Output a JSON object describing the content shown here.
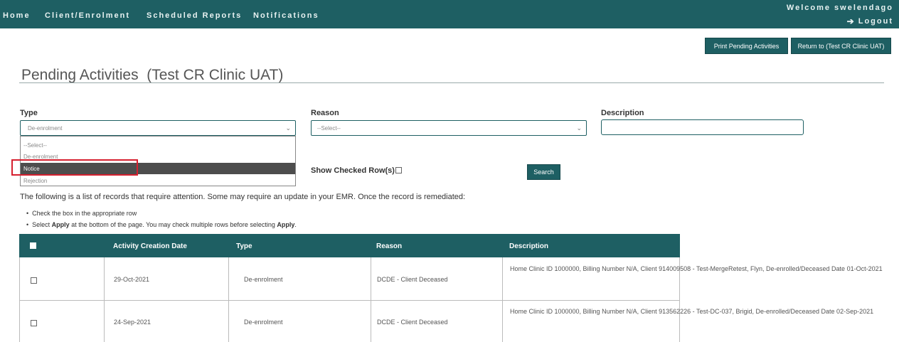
{
  "nav": {
    "items": [
      "Home",
      "Client/Enrolment",
      "Scheduled Reports",
      "Notifications"
    ],
    "welcome": "Welcome swelendago",
    "logout": "Logout"
  },
  "actions": {
    "print_label": "Print Pending Activities",
    "return_label": "Return to (Test CR Clinic UAT)"
  },
  "page": {
    "title": "Pending Activities  (Test CR Clinic UAT)"
  },
  "filters": {
    "type_label": "Type",
    "type_value": "De-enrolment",
    "type_options": [
      "--Select--",
      "De-enrolment",
      "Notice",
      "Rejection"
    ],
    "type_highlighted": "Notice",
    "reason_label": "Reason",
    "reason_value": "--Select--",
    "description_label": "Description",
    "description_value": "",
    "show_checked_label": "Show Checked Row(s)",
    "search_label": "Search"
  },
  "info": {
    "text": "The following is a list of records that require attention. Some may require an update in your EMR. Once the record is remediated:",
    "bullet1": "Check the box in the appropriate row",
    "bullet2_pre": "Select ",
    "bullet2_bold1": "Apply",
    "bullet2_mid": " at the bottom of the page. You may check multiple rows before selecting ",
    "bullet2_bold2": "Apply",
    "bullet2_end": "."
  },
  "table": {
    "headers": [
      "Activity Creation Date",
      "Type",
      "Reason",
      "Description"
    ],
    "rows": [
      {
        "date": "29-Oct-2021",
        "type": "De-enrolment",
        "reason": "DCDE - Client Deceased",
        "description": "Home Clinic ID 1000000, Billing Number N/A, Client 914009508 - Test-MergeRetest, Flyn, De-enrolled/Deceased Date 01-Oct-2021"
      },
      {
        "date": "24-Sep-2021",
        "type": "De-enrolment",
        "reason": "DCDE - Client Deceased",
        "description": "Home Clinic ID 1000000, Billing Number N/A, Client 913562226 - Test-DC-037, Brigid, De-enrolled/Deceased Date 02-Sep-2021"
      }
    ]
  },
  "colors": {
    "brand": "#1e5f63",
    "highlight_border": "#d6202f",
    "selected_option": "#4d4d4d"
  }
}
